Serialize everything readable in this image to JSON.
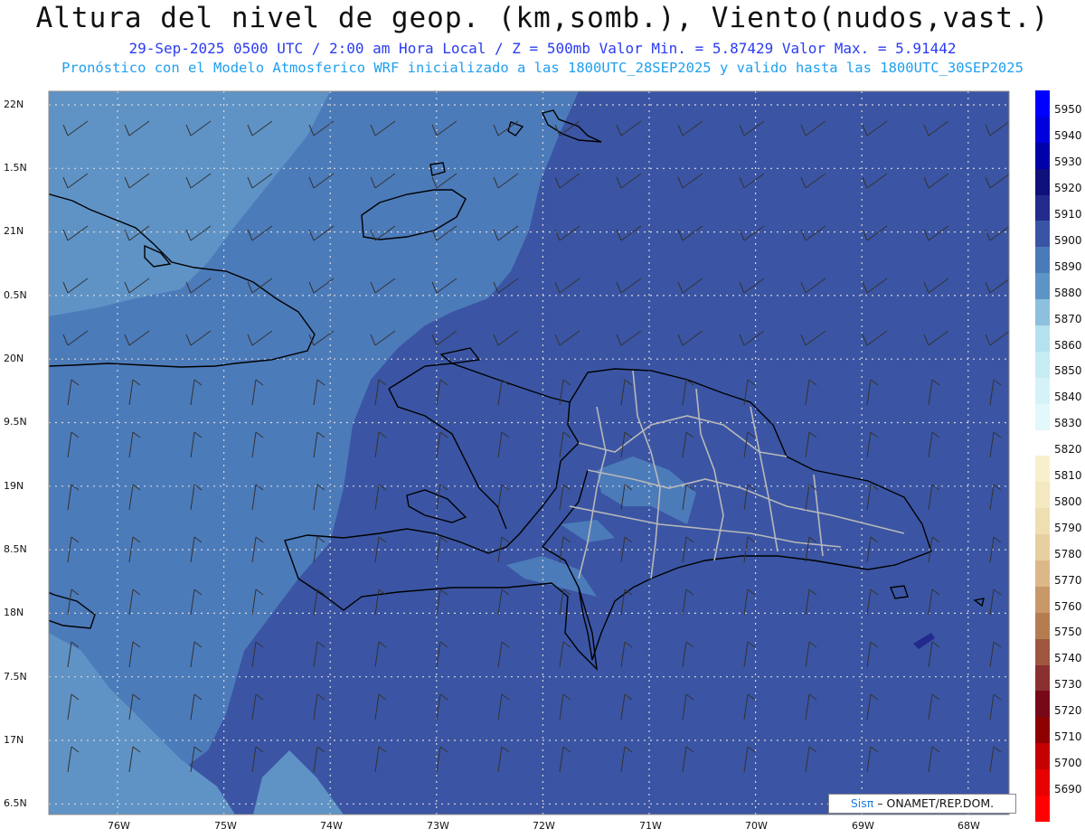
{
  "header": {
    "title": "Altura del nivel de geop. (km,somb.), Viento(nudos,vast.)",
    "line1": "29-Sep-2025  0500 UTC / 2:00 am Hora Local / Z = 500mb    Valor Min. = 5.87429  Valor Max. = 5.91442",
    "line2": "Pronóstico con el Modelo Atmosferico WRF inicializado a las 1800UTC_28SEP2025 y valido hasta las  1800UTC_30SEP2025"
  },
  "axes": {
    "lat_labels": [
      "22N",
      "1.5N",
      "21N",
      "0.5N",
      "20N",
      "9.5N",
      "19N",
      "8.5N",
      "18N",
      "7.5N",
      "17N",
      "6.5N"
    ],
    "lon_labels": [
      "76W",
      "75W",
      "74W",
      "73W",
      "72W",
      "71W",
      "70W",
      "69W",
      "68W"
    ]
  },
  "colorbar": {
    "levels": [
      "5950",
      "5940",
      "5930",
      "5920",
      "5910",
      "5900",
      "5890",
      "5880",
      "5870",
      "5860",
      "5850",
      "5840",
      "5830",
      "5820",
      "5810",
      "5800",
      "5790",
      "5780",
      "5770",
      "5760",
      "5750",
      "5740",
      "5730",
      "5720",
      "5710",
      "5700",
      "5690"
    ],
    "colors": [
      "#0000ff",
      "#0000dd",
      "#0000a8",
      "#10107a",
      "#222a8c",
      "#3a54a5",
      "#4b7ab8",
      "#5d94c6",
      "#8cc0dc",
      "#b5e1ee",
      "#c6ecf4",
      "#d4f2f8",
      "#e2f8fb",
      "#ffffff",
      "#f8f0cc",
      "#f4e8c0",
      "#efdeb0",
      "#e8cfa0",
      "#dcb888",
      "#c99868",
      "#b57c50",
      "#9e5640",
      "#8a3030",
      "#770818",
      "#8e0000",
      "#c40000",
      "#e60000",
      "#ff0000"
    ]
  },
  "credit": {
    "sis": "Sisπ",
    "rest": "– ONAMET/REP.DOM."
  },
  "colors": {
    "deep": "#3b55a4",
    "mid": "#4c7bba",
    "light": "#5f93c6",
    "land_outline": "#000000",
    "province_outline": "#b8b8b8"
  }
}
